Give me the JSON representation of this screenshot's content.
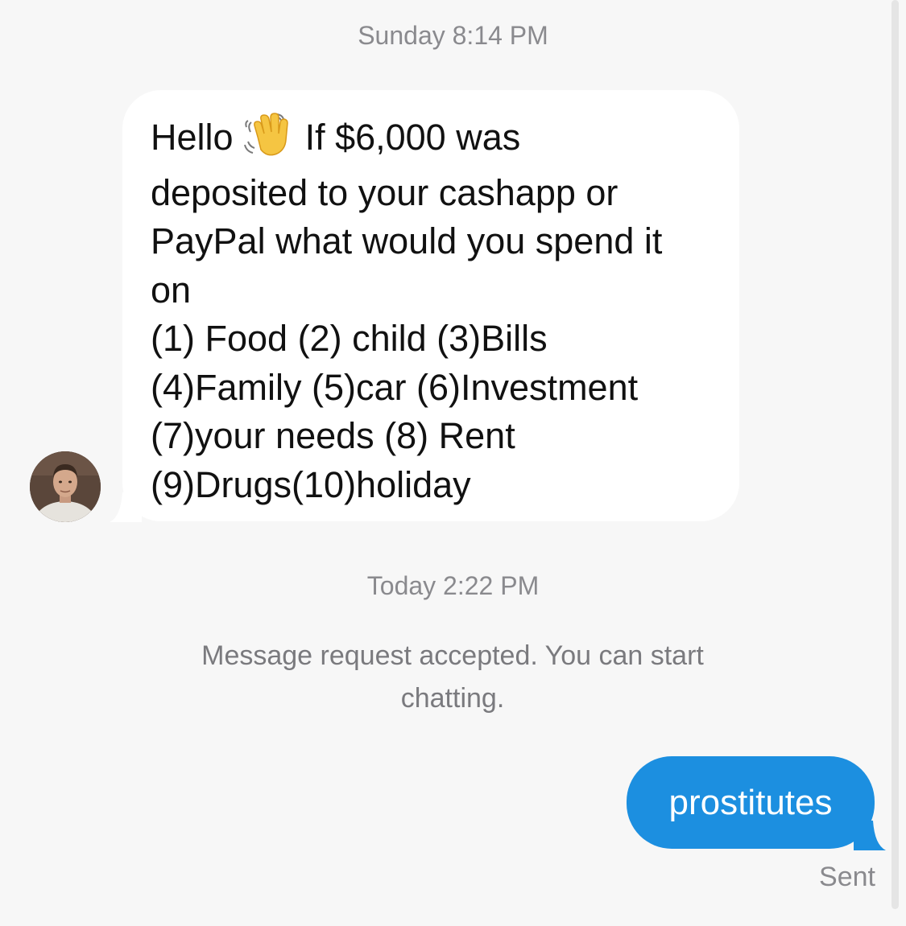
{
  "conversation": {
    "timestamp_1": "Sunday 8:14 PM",
    "incoming_message": {
      "text_before_emoji": "Hello ",
      "emoji": "waving-hand",
      "text_after_emoji": " If $6,000 was\ndeposited to your cashapp or\nPayPal what would you spend it\non\n(1) Food (2) child (3)Bills\n(4)Family (5)car (6)Investment\n(7)your needs (8) Rent\n(9)Drugs(10)holiday"
    },
    "timestamp_2": "Today 2:22 PM",
    "system_message": "Message request accepted. You can start chatting.",
    "outgoing_message": {
      "text": "prostitutes",
      "status": "Sent"
    }
  },
  "colors": {
    "background": "#f7f7f7",
    "incoming_bubble": "#ffffff",
    "outgoing_bubble": "#1c8fe0",
    "timestamp_text": "#8a8a8e"
  },
  "icons": {
    "avatar": "profile-photo",
    "emoji": "waving-hand-emoji"
  }
}
